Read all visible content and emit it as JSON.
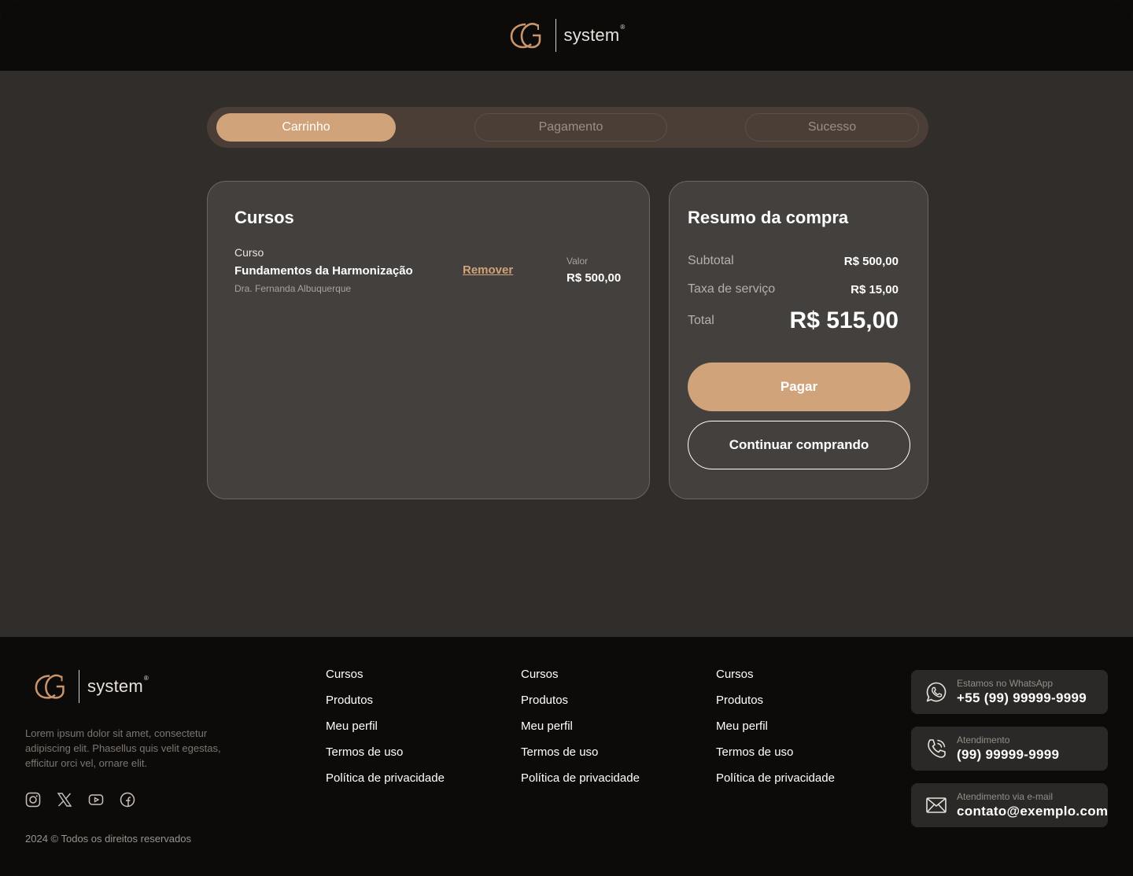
{
  "brand": {
    "logo_text": "system",
    "logo_mark": "®"
  },
  "stepper": {
    "steps": [
      {
        "label": "Carrinho",
        "state": "active"
      },
      {
        "label": "Pagamento",
        "state": "inactive"
      },
      {
        "label": "Sucesso",
        "state": "inactive"
      }
    ]
  },
  "cart": {
    "title": "Cursos",
    "items": [
      {
        "type": "Curso",
        "name": "Fundamentos da Harmonização",
        "author": "Dra. Fernanda Albuquerque",
        "remove_label": "Remover",
        "value_label": "Valor",
        "value": "R$ 500,00"
      }
    ]
  },
  "summary": {
    "title": "Resumo da compra",
    "subtotal_label": "Subtotal",
    "subtotal_value": "R$ 500,00",
    "fee_label": "Taxa de serviço",
    "fee_value": "R$ 15,00",
    "total_label": "Total",
    "total_value": "R$ 515,00",
    "pay_label": "Pagar",
    "continue_label": "Continuar comprando"
  },
  "footer": {
    "description": "Lorem ipsum dolor sit amet, consectetur adipiscing elit. Phasellus quis velit egestas, efficitur orci vel, ornare elit.",
    "socials": [
      "instagram-icon",
      "x-twitter-icon",
      "youtube-icon",
      "facebook-icon"
    ],
    "link_columns": [
      [
        "Cursos",
        "Produtos",
        "Meu perfil",
        "Termos de uso",
        "Política de privacidade"
      ],
      [
        "Cursos",
        "Produtos",
        "Meu perfil",
        "Termos de uso",
        "Política de privacidade"
      ],
      [
        "Cursos",
        "Produtos",
        "Meu perfil",
        "Termos de uso",
        "Política de privacidade"
      ]
    ],
    "contacts": [
      {
        "icon": "whatsapp-icon",
        "label": "Estamos no WhatsApp",
        "value": "+55 (99) 99999-9999"
      },
      {
        "icon": "phone-icon",
        "label": "Atendimento",
        "value": "(99) 99999-9999"
      },
      {
        "icon": "mail-icon",
        "label": "Atendimento via e-mail",
        "value": "contato@exemplo.com"
      }
    ],
    "copyright": "2024 © Todos os direitos reservados"
  },
  "colors": {
    "accent": "#d1a37a",
    "background": "#302d2b",
    "header_footer": "#0d0b0a",
    "card": "#43403d"
  }
}
